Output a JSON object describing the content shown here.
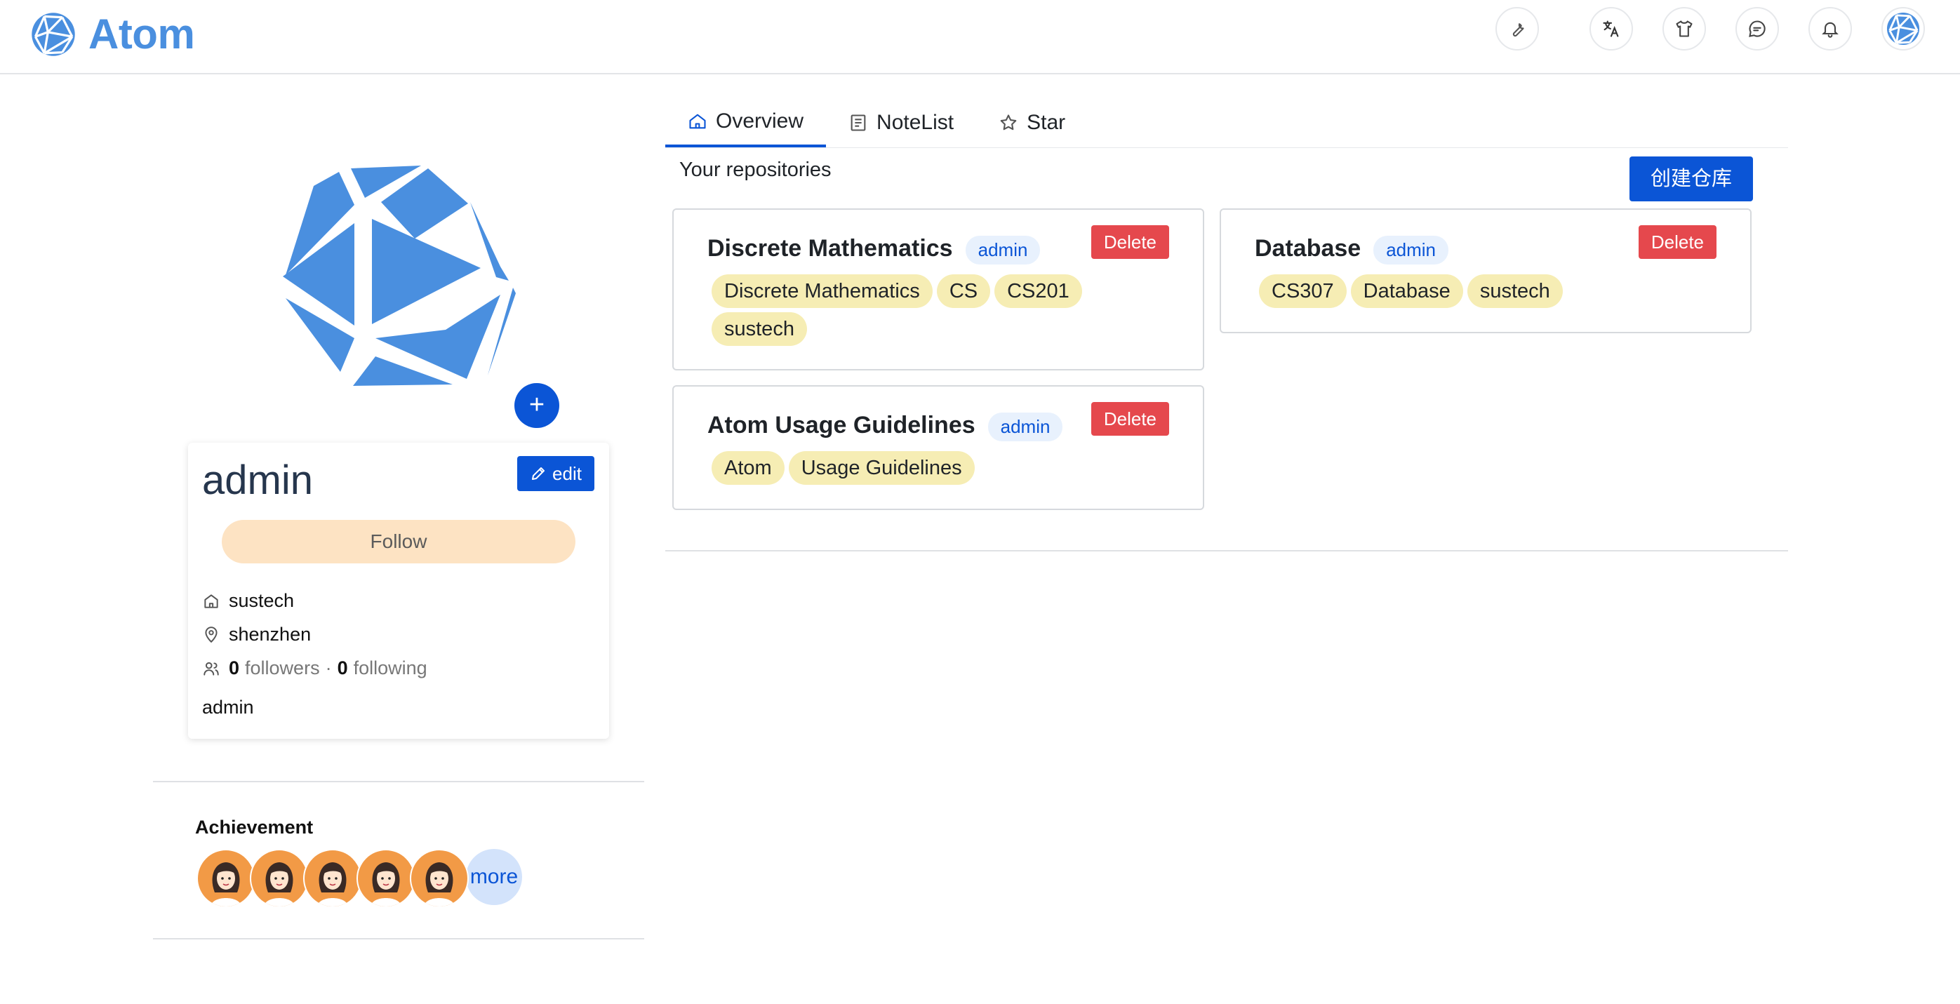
{
  "app": {
    "title": "Atom"
  },
  "header": {
    "icons": [
      "wrench-icon",
      "translate-icon",
      "shirt-icon",
      "chat-icon",
      "bell-icon",
      "user-avatar"
    ]
  },
  "profile": {
    "username": "admin",
    "edit_label": "edit",
    "follow_label": "Follow",
    "organization": "sustech",
    "location": "shenzhen",
    "followers_count": "0",
    "followers_label": "followers",
    "separator": "·",
    "following_count": "0",
    "following_label": "following",
    "bio": "admin",
    "add_avatar_label": "+"
  },
  "achievement": {
    "title": "Achievement",
    "more_label": "more",
    "badge_count": 5
  },
  "tabs": [
    {
      "label": "Overview",
      "icon": "home-icon",
      "active": true
    },
    {
      "label": "NoteList",
      "icon": "note-icon",
      "active": false
    },
    {
      "label": "Star",
      "icon": "star-icon",
      "active": false
    }
  ],
  "repositories": {
    "title": "Your repositories",
    "create_label": "创建仓库",
    "items": [
      {
        "name": "Discrete Mathematics",
        "owner": "admin",
        "delete_label": "Delete",
        "tags": [
          "Discrete Mathematics",
          "CS",
          "CS201",
          "sustech"
        ]
      },
      {
        "name": "Database",
        "owner": "admin",
        "delete_label": "Delete",
        "tags": [
          "CS307",
          "Database",
          "sustech"
        ]
      },
      {
        "name": "Atom Usage Guidelines",
        "owner": "admin",
        "delete_label": "Delete",
        "tags": [
          "Atom",
          "Usage Guidelines"
        ]
      }
    ]
  },
  "colors": {
    "primary": "#0b55d6",
    "logo": "#4a8fdf",
    "danger": "#e5484d",
    "tag_bg": "#f6edb4",
    "follow_bg": "#fde3c3"
  }
}
